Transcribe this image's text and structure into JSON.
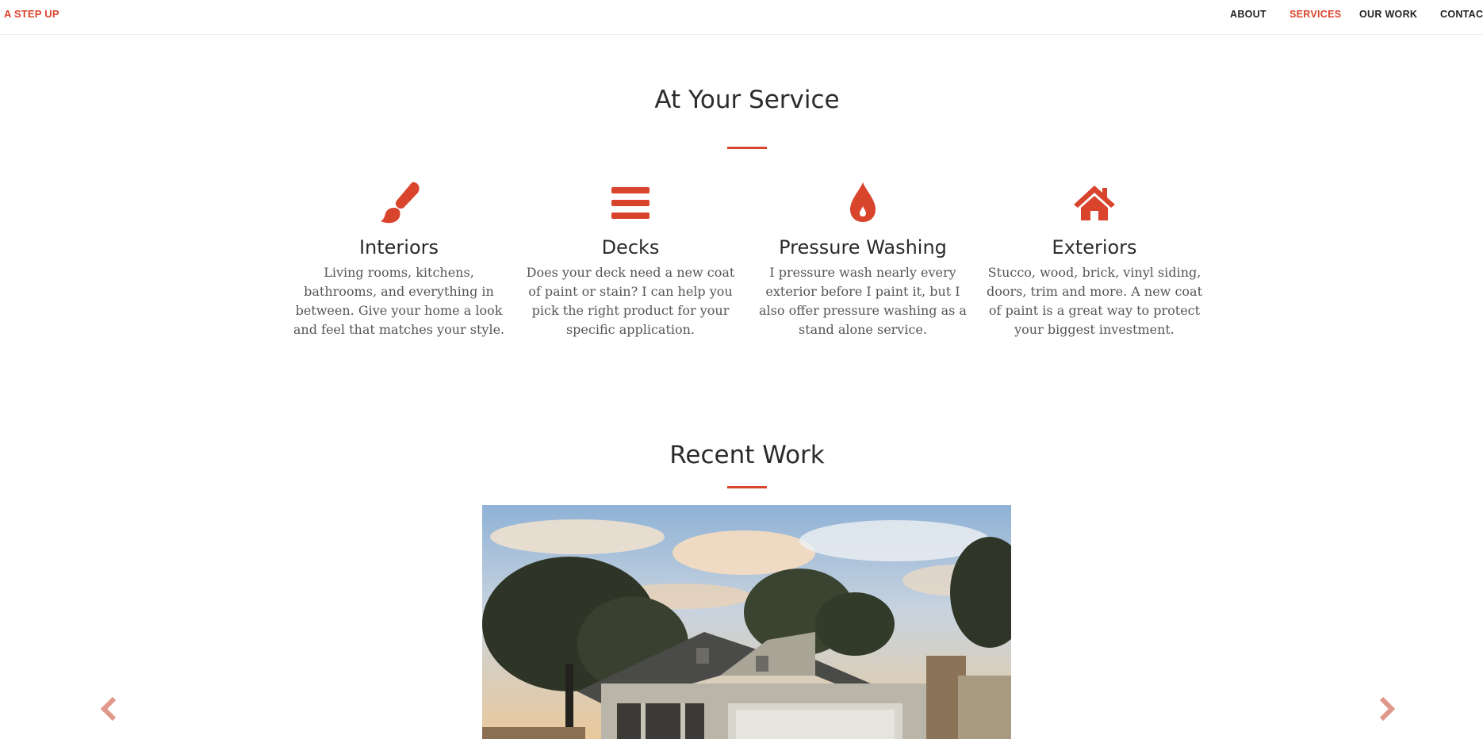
{
  "brand": "A STEP UP",
  "nav": {
    "items": [
      {
        "label": "ABOUT"
      },
      {
        "label": "SERVICES"
      },
      {
        "label": "OUR WORK"
      },
      {
        "label": "CONTAC"
      }
    ]
  },
  "services": {
    "title": "At Your Service",
    "items": [
      {
        "icon": "paintbrush-icon",
        "title": "Interiors",
        "text": "Living rooms, kitchens, bathrooms, and everything in between. Give your home a look and feel that matches your style."
      },
      {
        "icon": "bars-icon",
        "title": "Decks",
        "text": "Does your deck need a new coat of paint or stain? I can help you pick the right product for your specific application."
      },
      {
        "icon": "drop-icon",
        "title": "Pressure Washing",
        "text": "I pressure wash nearly every exterior before I paint it, but I also offer pressure washing as a stand alone service."
      },
      {
        "icon": "home-icon",
        "title": "Exteriors",
        "text": "Stucco, wood, brick, vinyl siding, doors, trim and more. A new coat of paint is a great way to protect your biggest investment."
      }
    ]
  },
  "recent_work": {
    "title": "Recent Work",
    "photo": "house-photo",
    "prev_icon": "chevron-left-icon",
    "next_icon": "chevron-right-icon"
  },
  "colors": {
    "accent": "#d9442c",
    "text": "#2b2b2b",
    "body_text": "#555555"
  }
}
